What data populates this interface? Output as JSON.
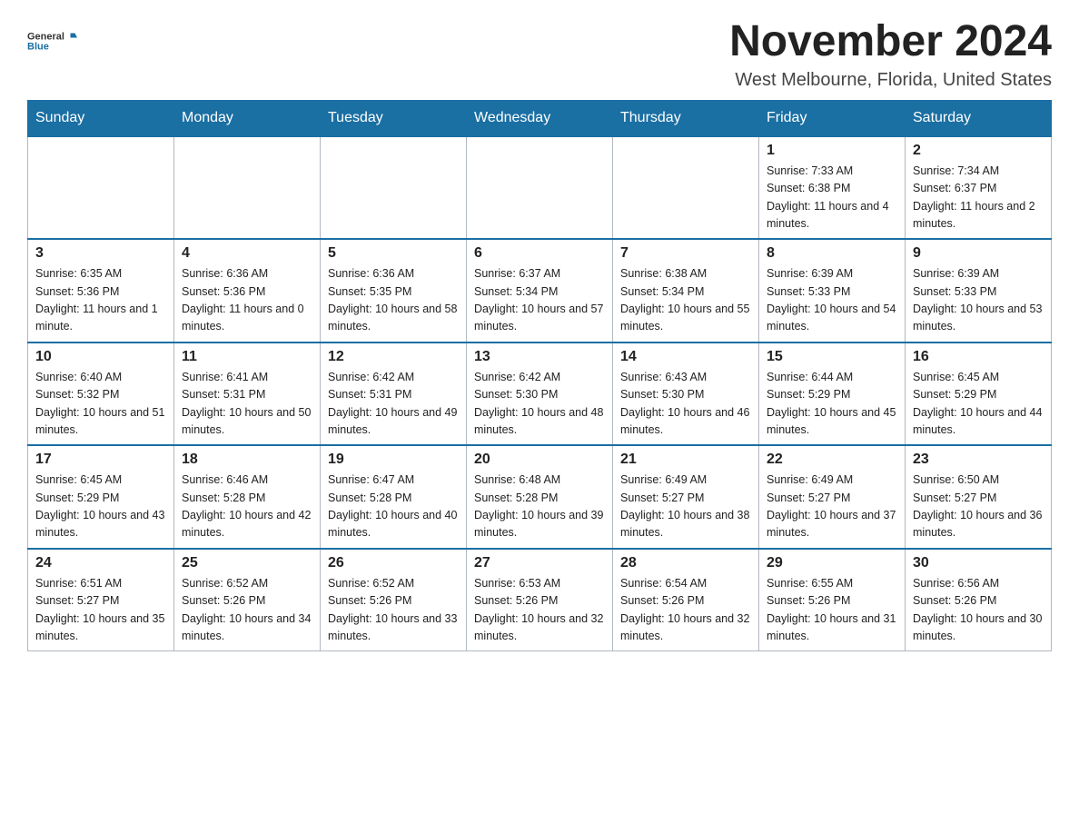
{
  "header": {
    "logo_general": "General",
    "logo_blue": "Blue",
    "month_title": "November 2024",
    "location": "West Melbourne, Florida, United States"
  },
  "days_of_week": [
    "Sunday",
    "Monday",
    "Tuesday",
    "Wednesday",
    "Thursday",
    "Friday",
    "Saturday"
  ],
  "weeks": [
    [
      {
        "day": "",
        "info": ""
      },
      {
        "day": "",
        "info": ""
      },
      {
        "day": "",
        "info": ""
      },
      {
        "day": "",
        "info": ""
      },
      {
        "day": "",
        "info": ""
      },
      {
        "day": "1",
        "info": "Sunrise: 7:33 AM\nSunset: 6:38 PM\nDaylight: 11 hours and 4 minutes."
      },
      {
        "day": "2",
        "info": "Sunrise: 7:34 AM\nSunset: 6:37 PM\nDaylight: 11 hours and 2 minutes."
      }
    ],
    [
      {
        "day": "3",
        "info": "Sunrise: 6:35 AM\nSunset: 5:36 PM\nDaylight: 11 hours and 1 minute."
      },
      {
        "day": "4",
        "info": "Sunrise: 6:36 AM\nSunset: 5:36 PM\nDaylight: 11 hours and 0 minutes."
      },
      {
        "day": "5",
        "info": "Sunrise: 6:36 AM\nSunset: 5:35 PM\nDaylight: 10 hours and 58 minutes."
      },
      {
        "day": "6",
        "info": "Sunrise: 6:37 AM\nSunset: 5:34 PM\nDaylight: 10 hours and 57 minutes."
      },
      {
        "day": "7",
        "info": "Sunrise: 6:38 AM\nSunset: 5:34 PM\nDaylight: 10 hours and 55 minutes."
      },
      {
        "day": "8",
        "info": "Sunrise: 6:39 AM\nSunset: 5:33 PM\nDaylight: 10 hours and 54 minutes."
      },
      {
        "day": "9",
        "info": "Sunrise: 6:39 AM\nSunset: 5:33 PM\nDaylight: 10 hours and 53 minutes."
      }
    ],
    [
      {
        "day": "10",
        "info": "Sunrise: 6:40 AM\nSunset: 5:32 PM\nDaylight: 10 hours and 51 minutes."
      },
      {
        "day": "11",
        "info": "Sunrise: 6:41 AM\nSunset: 5:31 PM\nDaylight: 10 hours and 50 minutes."
      },
      {
        "day": "12",
        "info": "Sunrise: 6:42 AM\nSunset: 5:31 PM\nDaylight: 10 hours and 49 minutes."
      },
      {
        "day": "13",
        "info": "Sunrise: 6:42 AM\nSunset: 5:30 PM\nDaylight: 10 hours and 48 minutes."
      },
      {
        "day": "14",
        "info": "Sunrise: 6:43 AM\nSunset: 5:30 PM\nDaylight: 10 hours and 46 minutes."
      },
      {
        "day": "15",
        "info": "Sunrise: 6:44 AM\nSunset: 5:29 PM\nDaylight: 10 hours and 45 minutes."
      },
      {
        "day": "16",
        "info": "Sunrise: 6:45 AM\nSunset: 5:29 PM\nDaylight: 10 hours and 44 minutes."
      }
    ],
    [
      {
        "day": "17",
        "info": "Sunrise: 6:45 AM\nSunset: 5:29 PM\nDaylight: 10 hours and 43 minutes."
      },
      {
        "day": "18",
        "info": "Sunrise: 6:46 AM\nSunset: 5:28 PM\nDaylight: 10 hours and 42 minutes."
      },
      {
        "day": "19",
        "info": "Sunrise: 6:47 AM\nSunset: 5:28 PM\nDaylight: 10 hours and 40 minutes."
      },
      {
        "day": "20",
        "info": "Sunrise: 6:48 AM\nSunset: 5:28 PM\nDaylight: 10 hours and 39 minutes."
      },
      {
        "day": "21",
        "info": "Sunrise: 6:49 AM\nSunset: 5:27 PM\nDaylight: 10 hours and 38 minutes."
      },
      {
        "day": "22",
        "info": "Sunrise: 6:49 AM\nSunset: 5:27 PM\nDaylight: 10 hours and 37 minutes."
      },
      {
        "day": "23",
        "info": "Sunrise: 6:50 AM\nSunset: 5:27 PM\nDaylight: 10 hours and 36 minutes."
      }
    ],
    [
      {
        "day": "24",
        "info": "Sunrise: 6:51 AM\nSunset: 5:27 PM\nDaylight: 10 hours and 35 minutes."
      },
      {
        "day": "25",
        "info": "Sunrise: 6:52 AM\nSunset: 5:26 PM\nDaylight: 10 hours and 34 minutes."
      },
      {
        "day": "26",
        "info": "Sunrise: 6:52 AM\nSunset: 5:26 PM\nDaylight: 10 hours and 33 minutes."
      },
      {
        "day": "27",
        "info": "Sunrise: 6:53 AM\nSunset: 5:26 PM\nDaylight: 10 hours and 32 minutes."
      },
      {
        "day": "28",
        "info": "Sunrise: 6:54 AM\nSunset: 5:26 PM\nDaylight: 10 hours and 32 minutes."
      },
      {
        "day": "29",
        "info": "Sunrise: 6:55 AM\nSunset: 5:26 PM\nDaylight: 10 hours and 31 minutes."
      },
      {
        "day": "30",
        "info": "Sunrise: 6:56 AM\nSunset: 5:26 PM\nDaylight: 10 hours and 30 minutes."
      }
    ]
  ]
}
